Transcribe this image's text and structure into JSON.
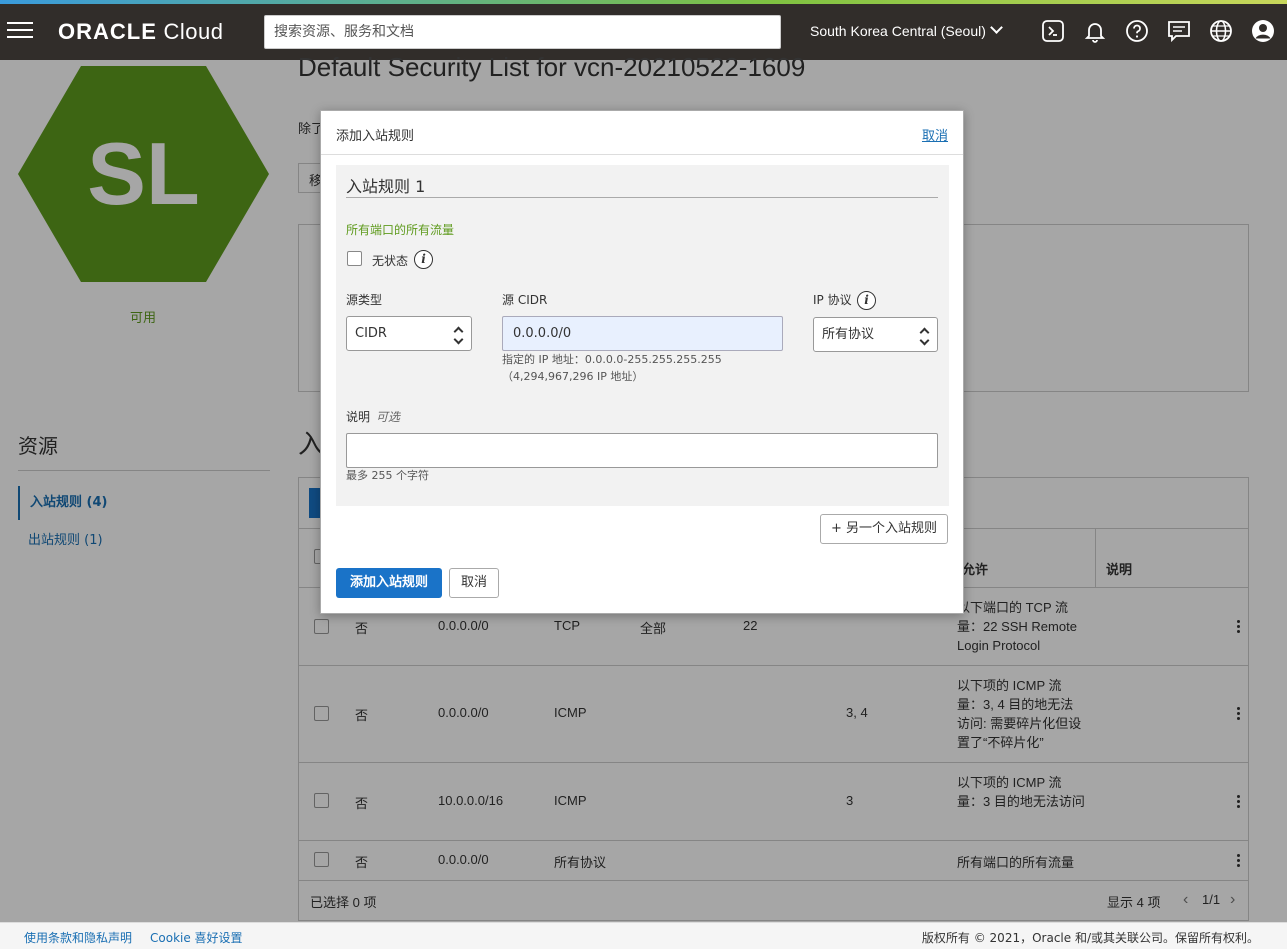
{
  "topbar": {
    "logo_bold": "ORACLE",
    "logo_light": "Cloud",
    "search_placeholder": "搜索资源、服务和文档",
    "region": "South Korea Central (Seoul)",
    "icons": [
      "menu-icon",
      "cloud-shell-icon",
      "bell-icon",
      "help-icon",
      "chat-icon",
      "globe-icon",
      "profile-icon"
    ]
  },
  "page": {
    "badge": "SL",
    "badge_color": "#5f9b1e",
    "status": "可用",
    "title": "Default Security List for vcn-20210522-1609",
    "desc_fragment": "除了",
    "move_fragment": "移",
    "ingress_fragment": "入",
    "resources_heading": "资源",
    "resources": [
      {
        "label": "入站规则 (4)",
        "active": true
      },
      {
        "label": "出站规则 (1)",
        "active": false
      }
    ],
    "table": {
      "allow_header": "允许",
      "desc_header": "说明",
      "rows": [
        {
          "stateless": "否",
          "source": "0.0.0.0/0",
          "protocol": "TCP",
          "src_port": "全部",
          "dst_port": "22",
          "type_code": "",
          "allow": "以下端口的 TCP 流量：22 SSH Remote Login Protocol"
        },
        {
          "stateless": "否",
          "source": "0.0.0.0/0",
          "protocol": "ICMP",
          "src_port": "",
          "dst_port": "",
          "type_code": "3, 4",
          "allow": "以下项的 ICMP 流量：3, 4 目的地无法访问: 需要碎片化但设置了“不碎片化”"
        },
        {
          "stateless": "否",
          "source": "10.0.0.0/16",
          "protocol": "ICMP",
          "src_port": "",
          "dst_port": "",
          "type_code": "3",
          "allow": "以下项的 ICMP 流量：3 目的地无法访问"
        },
        {
          "stateless": "否",
          "source": "0.0.0.0/0",
          "protocol": "所有协议",
          "src_port": "",
          "dst_port": "",
          "type_code": "",
          "allow": "所有端口的所有流量"
        }
      ],
      "selected": "已选择 0 项",
      "showing": "显示 4 项",
      "pager": "1/1"
    }
  },
  "modal": {
    "title": "添加入站规则",
    "cancel_link": "取消",
    "rule_title": "入站规则 1",
    "green_note": "所有端口的所有流量",
    "stateless_label": "无状态",
    "source_type_label": "源类型",
    "source_type_value": "CIDR",
    "source_cidr_label": "源 CIDR",
    "source_cidr_value": "0.0.0.0/0",
    "cidr_help_1": "指定的 IP 地址：0.0.0.0-255.255.255.255",
    "cidr_help_2": "（4,294,967,296 IP 地址）",
    "ip_protocol_label": "IP 协议",
    "ip_protocol_value": "所有协议",
    "desc_label": "说明",
    "desc_optional": "可选",
    "desc_value": "",
    "desc_help": "最多 255 个字符",
    "another_rule_button": "+ 另一个入站规则",
    "submit_button": "添加入站规则",
    "cancel_button": "取消"
  },
  "footer": {
    "terms": "使用条款和隐私声明",
    "cookie": "Cookie 喜好设置",
    "copyright": "版权所有 © 2021，Oracle 和/或其关联公司。保留所有权利。"
  }
}
